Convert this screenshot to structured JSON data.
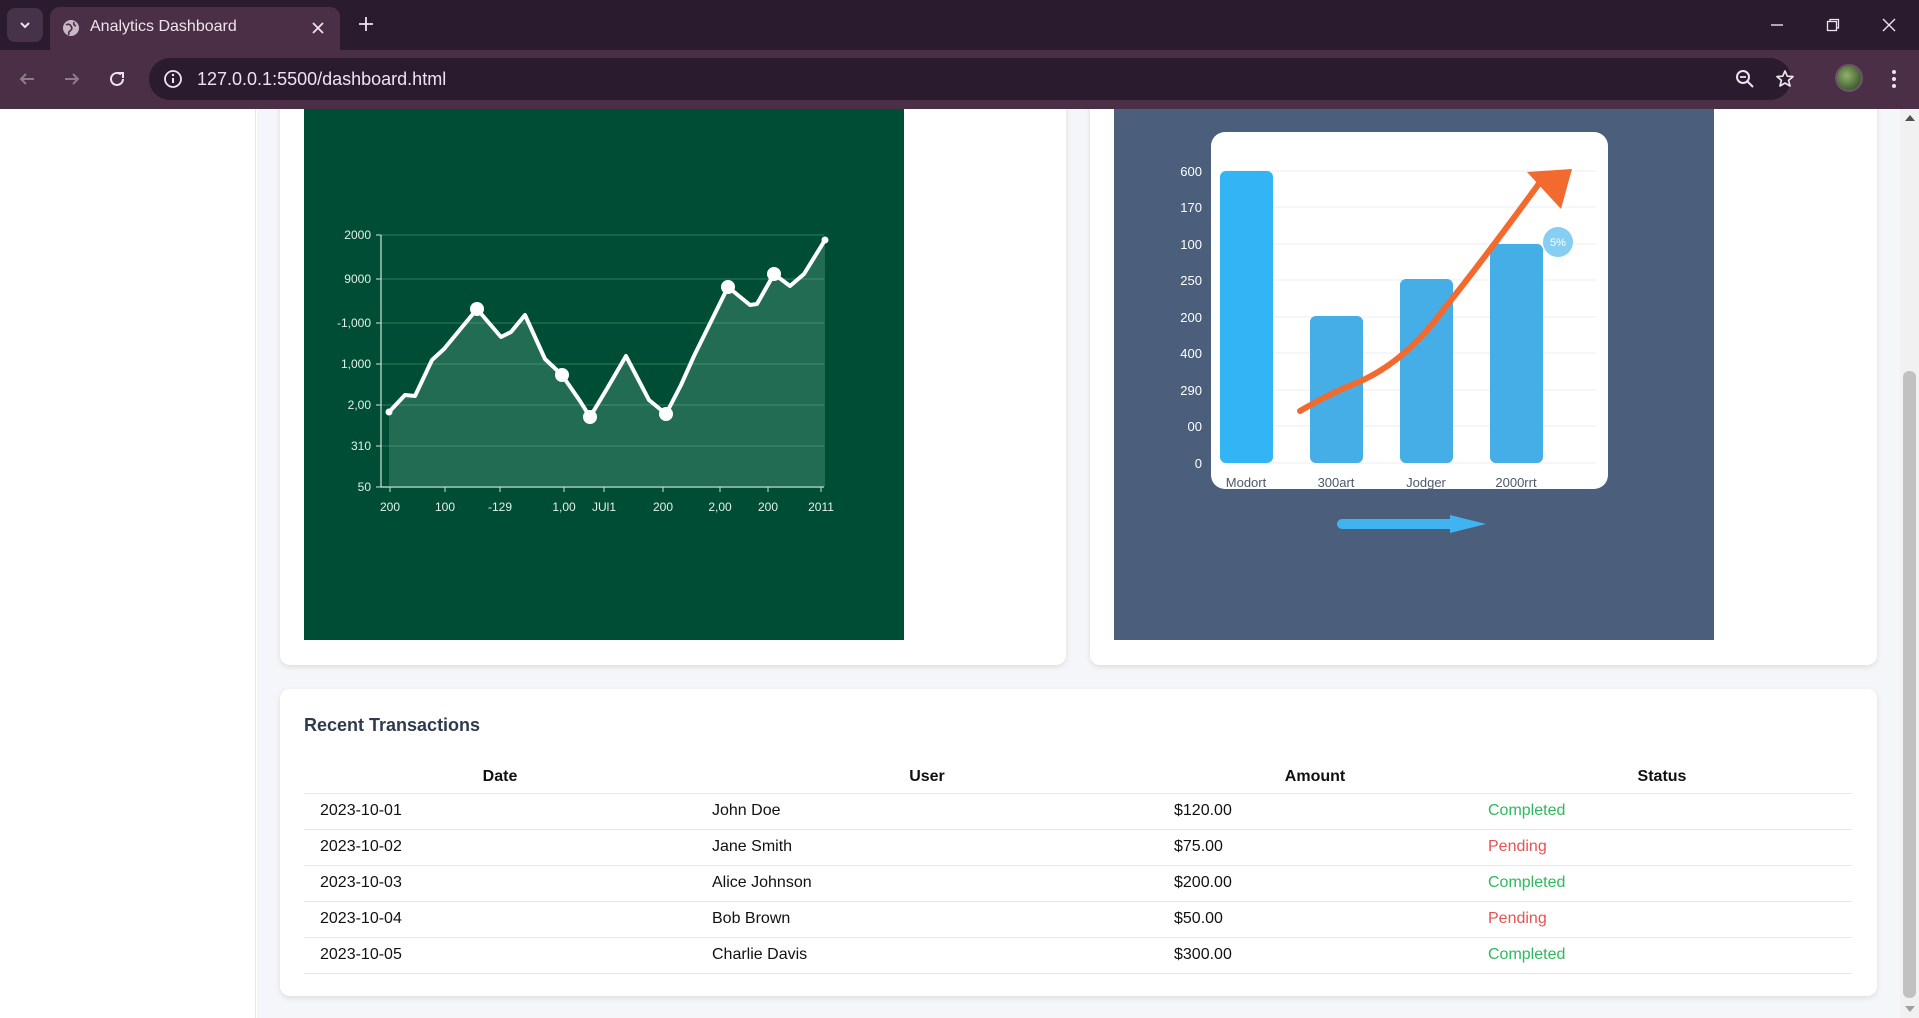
{
  "browser": {
    "tab_title": "Analytics Dashboard",
    "url": "127.0.0.1:5500/dashboard.html"
  },
  "colors": {
    "chrome_dark": "#2b1b2e",
    "chrome_toolbar": "#4a2f46",
    "completed": "#2eb85c",
    "pending": "#e55353",
    "line_chart_bg": "#004d35",
    "bar_chart_bg": "#4b5f7c",
    "bar_fill": "#3bb0ef",
    "trend_arrow": "#f26a2e"
  },
  "line_chart": {
    "y_ticks": [
      "2000",
      "9000",
      "-1,000",
      "1,000",
      "2,00",
      "310",
      "50"
    ],
    "x_ticks": [
      "200",
      "100",
      "-129",
      "1,00",
      "JUl1",
      "200",
      "2,00",
      "200",
      "2011"
    ]
  },
  "bar_chart": {
    "y_ticks": [
      "600",
      "170",
      "100",
      "250",
      "200",
      "400",
      "290",
      "00",
      "0"
    ],
    "categories": [
      "Modort",
      "300art",
      "Jodger",
      "2000rrt"
    ],
    "badge": "5%"
  },
  "transactions": {
    "title": "Recent Transactions",
    "headers": [
      "Date",
      "User",
      "Amount",
      "Status"
    ],
    "rows": [
      {
        "date": "2023-10-01",
        "user": "John Doe",
        "amount": "$120.00",
        "status": "Completed"
      },
      {
        "date": "2023-10-02",
        "user": "Jane Smith",
        "amount": "$75.00",
        "status": "Pending"
      },
      {
        "date": "2023-10-03",
        "user": "Alice Johnson",
        "amount": "$200.00",
        "status": "Completed"
      },
      {
        "date": "2023-10-04",
        "user": "Bob Brown",
        "amount": "$50.00",
        "status": "Pending"
      },
      {
        "date": "2023-10-05",
        "user": "Charlie Davis",
        "amount": "$300.00",
        "status": "Completed"
      }
    ]
  }
}
